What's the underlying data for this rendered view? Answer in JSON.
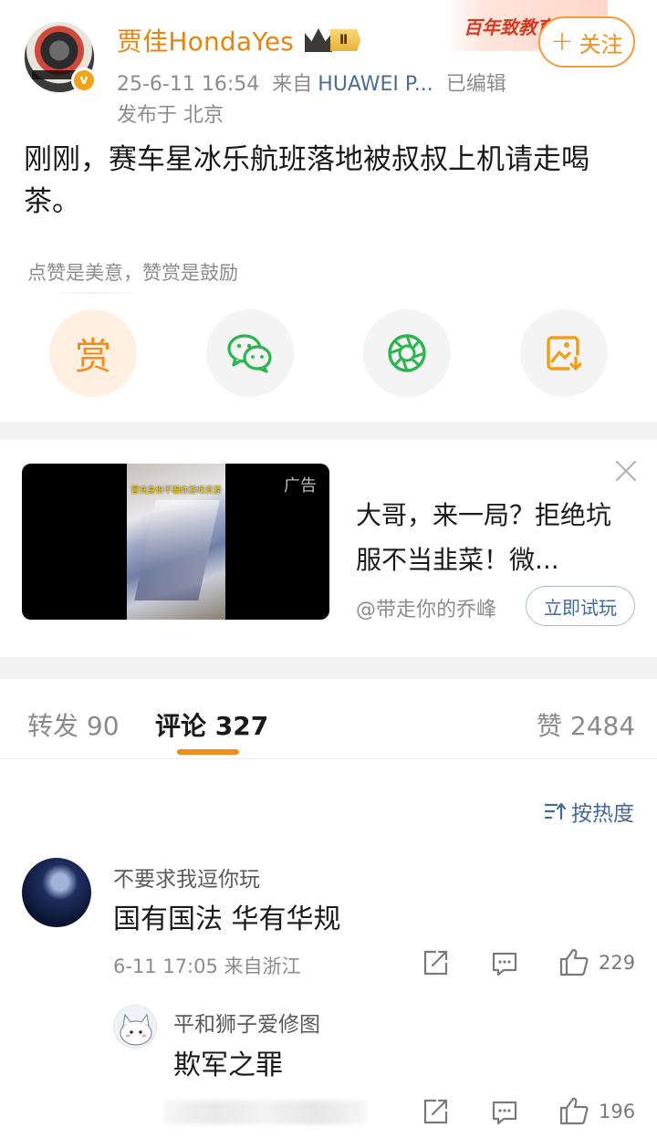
{
  "post": {
    "username": "贾佳HondaYes",
    "vip_level": "Ⅱ",
    "timestamp": "25-6-11 16:54",
    "source_prefix": "来自",
    "source": "HUAWEI P...",
    "edited": "已编辑",
    "location": "发布于 北京",
    "follow_label": "关注",
    "promo_text": "百年致教育",
    "text": "刚刚，赛车星冰乐航班落地被叔叔上机请走喝茶。",
    "reward_hint": "点赞是美意，赞赏是鼓励",
    "reward_char": "赏"
  },
  "ad": {
    "tag": "广告",
    "video_caption": "冒充身份不骗你游戏资源",
    "title": "大哥，来一局？拒绝坑服不当韭菜！微...",
    "source": "@带走你的乔峰",
    "cta": "立即试玩"
  },
  "tabs": {
    "repost": "转发 90",
    "comments": "评论 327",
    "likes": "赞 2484"
  },
  "sort_label": "按热度",
  "comments": [
    {
      "name": "不要求我逗你玩",
      "text": "国有国法 华有华规",
      "meta": "6-11 17:05 来自浙江",
      "likes": "229"
    },
    {
      "name": "平和狮子爱修图",
      "text": "欺军之罪",
      "likes": "196"
    }
  ],
  "colors": {
    "accent": "#f28c1a",
    "link": "#44689a",
    "separator": "#f2f2f2"
  }
}
